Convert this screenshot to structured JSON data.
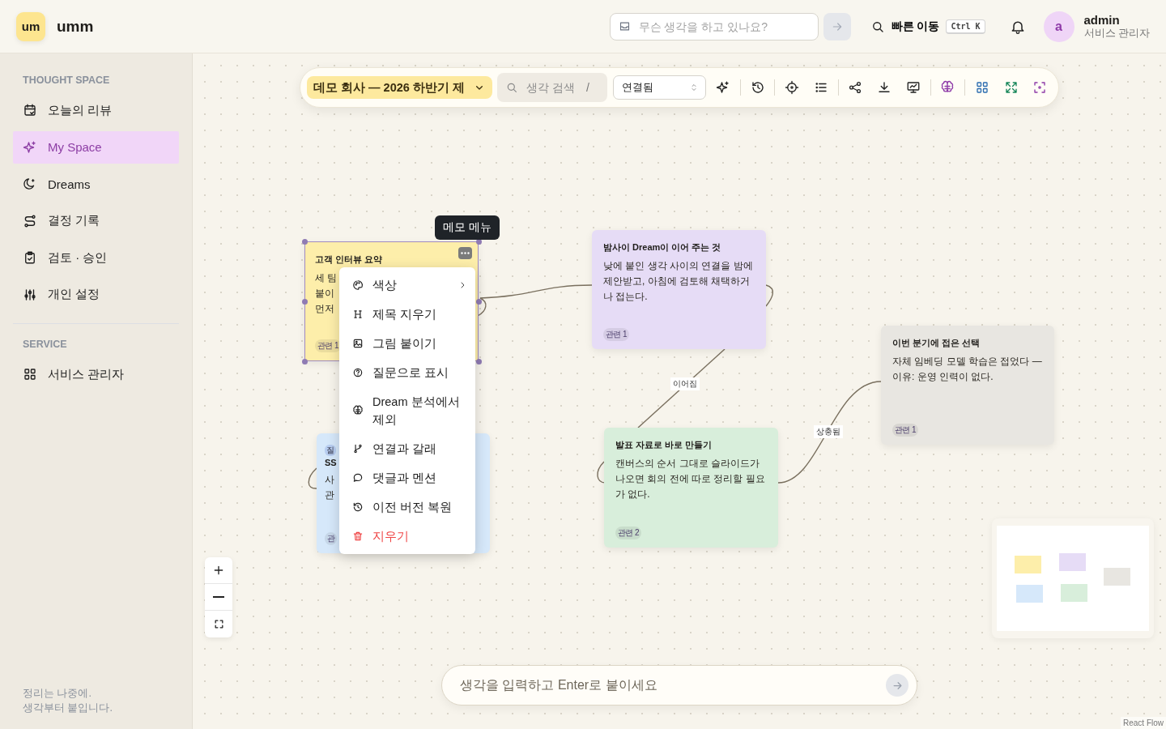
{
  "header": {
    "logo_mark": "um",
    "app_name": "umm",
    "composer": {
      "placeholder": "무슨 생각을 하고 있나요?"
    },
    "quick_jump": {
      "label": "빠른 이동",
      "shortcut": "Ctrl K"
    },
    "user": {
      "avatar": "a",
      "name": "admin",
      "role": "서비스 관리자"
    }
  },
  "sidebar": {
    "sections": [
      {
        "title": "THOUGHT SPACE",
        "items": [
          {
            "label": "오늘의 리뷰",
            "selected": false
          },
          {
            "label": "My Space",
            "selected": true
          },
          {
            "label": "Dreams",
            "selected": false
          },
          {
            "label": "결정 기록",
            "selected": false
          },
          {
            "label": "검토 · 승인",
            "selected": false
          },
          {
            "label": "개인 설정",
            "selected": false
          }
        ]
      },
      {
        "title": "SERVICE",
        "items": [
          {
            "label": "서비스 관리자",
            "selected": false
          }
        ]
      }
    ],
    "footer": "정리는 나중에.\n생각부터 붙입니다."
  },
  "toolbar": {
    "project": "데모 회사 — 2026 하반기 제",
    "search": {
      "placeholder": "생각 검색",
      "shortcut": "/"
    },
    "filter": "연결됨"
  },
  "canvas": {
    "nodes": [
      {
        "color": "#fdeeaa",
        "selected": true,
        "title": "고객 인터뷰 요약",
        "body": "세 팀\n붙이\n먼저",
        "badge": "관련 1"
      },
      {
        "color": "#e6dcf6",
        "selected": false,
        "title": "밤사이 Dream이 이어 주는 것",
        "body": "낮에 붙인 생각 사이의 연결을 밤에 제안받고, 아침에 검토해 채택하거나 접는다.",
        "badge": "관련 1"
      },
      {
        "color": "#e8e6e1",
        "selected": false,
        "title": "이번 분기에 접은 선택",
        "body": "자체 임베딩 모델 학습은 접었다 — 이유: 운영 인력이 없다.",
        "badge": "관련 1"
      },
      {
        "color": "#d6e8fa",
        "selected": false,
        "tag": "질",
        "title": "SS",
        "body": "사\n관",
        "badge": "관"
      },
      {
        "color": "#d8eedb",
        "selected": false,
        "title": "발표 자료로 바로 만들기",
        "body": "캔버스의 순서 그대로 슬라이드가 나오면 회의 전에 따로 정리할 필요가 없다.",
        "badge": "관련 2"
      }
    ],
    "edge_labels": [
      {
        "label": "이어짐"
      },
      {
        "label": "상충됨"
      }
    ],
    "context_menu": {
      "tooltip": "메모 메뉴",
      "items": [
        {
          "label": "색상",
          "kind": "submenu"
        },
        {
          "label": "제목 지우기",
          "kind": "normal"
        },
        {
          "label": "그림 붙이기",
          "kind": "normal"
        },
        {
          "label": "질문으로 표시",
          "kind": "normal"
        },
        {
          "label": "Dream 분석에서 제외",
          "kind": "normal"
        },
        {
          "label": "연결과 갈래",
          "kind": "normal"
        },
        {
          "label": "댓글과 멘션",
          "kind": "normal"
        },
        {
          "label": "이전 버전 복원",
          "kind": "normal"
        },
        {
          "label": "지우기",
          "kind": "danger"
        }
      ]
    },
    "composer": {
      "placeholder": "생각을 입력하고 Enter로 붙이세요"
    },
    "attribution": "React Flow"
  }
}
